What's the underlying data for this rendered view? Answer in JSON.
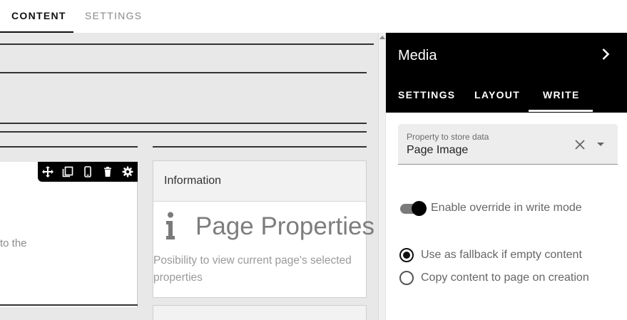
{
  "top_tabs": [
    {
      "label": "CONTENT",
      "active": true
    },
    {
      "label": "SETTINGS",
      "active": false
    }
  ],
  "canvas": {
    "partial_text": "to the",
    "toolbar_icons": [
      "move-icon",
      "copy-icon",
      "mobile-icon",
      "delete-icon",
      "settings-gear-icon"
    ],
    "info_card": {
      "header": "Information",
      "icon": "info-icon",
      "title": "Page Properties",
      "description": "Posibility to view current page's selected properties"
    }
  },
  "panel": {
    "title": "Media",
    "close_icon": "chevron-right-icon",
    "tabs": [
      {
        "label": "SETTINGS",
        "active": false
      },
      {
        "label": "LAYOUT",
        "active": false
      },
      {
        "label": "WRITE",
        "active": true
      }
    ],
    "property_field": {
      "label": "Property to store data",
      "value": "Page Image"
    },
    "override_toggle": {
      "label": "Enable override in write mode",
      "on": true
    },
    "radio_options": [
      {
        "label": "Use as fallback if empty content",
        "checked": true
      },
      {
        "label": "Copy content to page on creation",
        "checked": false
      }
    ]
  },
  "colors": {
    "panel_header": "#000000",
    "canvas_bg": "#e8e8e8",
    "accent": "#111111"
  }
}
